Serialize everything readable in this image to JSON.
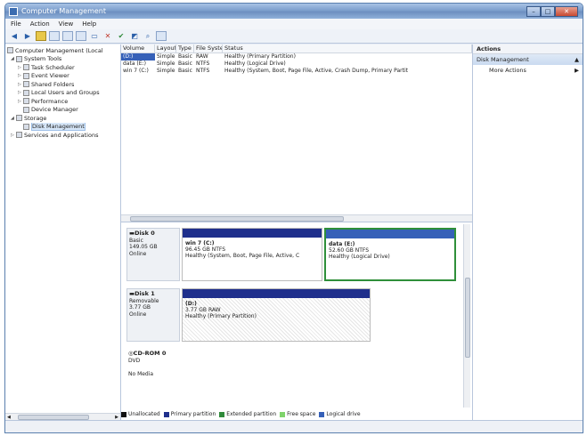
{
  "window": {
    "title": "Computer Management"
  },
  "menu": [
    "File",
    "Action",
    "View",
    "Help"
  ],
  "tree": [
    {
      "label": "Computer Management (Local",
      "indent": 0
    },
    {
      "label": "System Tools",
      "indent": 1
    },
    {
      "label": "Task Scheduler",
      "indent": 2
    },
    {
      "label": "Event Viewer",
      "indent": 2
    },
    {
      "label": "Shared Folders",
      "indent": 2
    },
    {
      "label": "Local Users and Groups",
      "indent": 2
    },
    {
      "label": "Performance",
      "indent": 2
    },
    {
      "label": "Device Manager",
      "indent": 2
    },
    {
      "label": "Storage",
      "indent": 1
    },
    {
      "label": "Disk Management",
      "indent": 2
    },
    {
      "label": "Services and Applications",
      "indent": 1
    }
  ],
  "volumes": {
    "headers": [
      "Volume",
      "Layout",
      "Type",
      "File System",
      "Status"
    ],
    "rows": [
      [
        "(D:)",
        "Simple",
        "Basic",
        "RAW",
        "Healthy (Primary Partition)"
      ],
      [
        "data (E:)",
        "Simple",
        "Basic",
        "NTFS",
        "Healthy (Logical Drive)"
      ],
      [
        "win 7 (C:)",
        "Simple",
        "Basic",
        "NTFS",
        "Healthy (System, Boot, Page File, Active, Crash Dump, Primary Partit"
      ]
    ]
  },
  "disks": {
    "disk0": {
      "name": "Disk 0",
      "type": "Basic",
      "size": "149.05 GB",
      "state": "Online",
      "part1": {
        "name": "win 7 (C:)",
        "size": "96.45 GB NTFS",
        "status": "Healthy (System, Boot, Page File, Active, C"
      },
      "part2": {
        "name": "data (E:)",
        "size": "52.60 GB NTFS",
        "status": "Healthy (Logical Drive)"
      }
    },
    "disk1": {
      "name": "Disk 1",
      "type": "Removable",
      "size": "3.77 GB",
      "state": "Online",
      "part1": {
        "name": "(D:)",
        "size": "3.77 GB RAW",
        "status": "Healthy (Primary Partition)"
      }
    },
    "cdrom": {
      "name": "CD-ROM 0",
      "type": "DVD",
      "state": "No Media"
    }
  },
  "legend": [
    "Unallocated",
    "Primary partition",
    "Extended partition",
    "Free space",
    "Logical drive"
  ],
  "legend_colors": [
    "#111111",
    "#1f2f8c",
    "#2f8a3a",
    "#7fd36b",
    "#3560b8"
  ],
  "actions": {
    "header": "Actions",
    "section": "Disk Management",
    "item": "More Actions"
  }
}
